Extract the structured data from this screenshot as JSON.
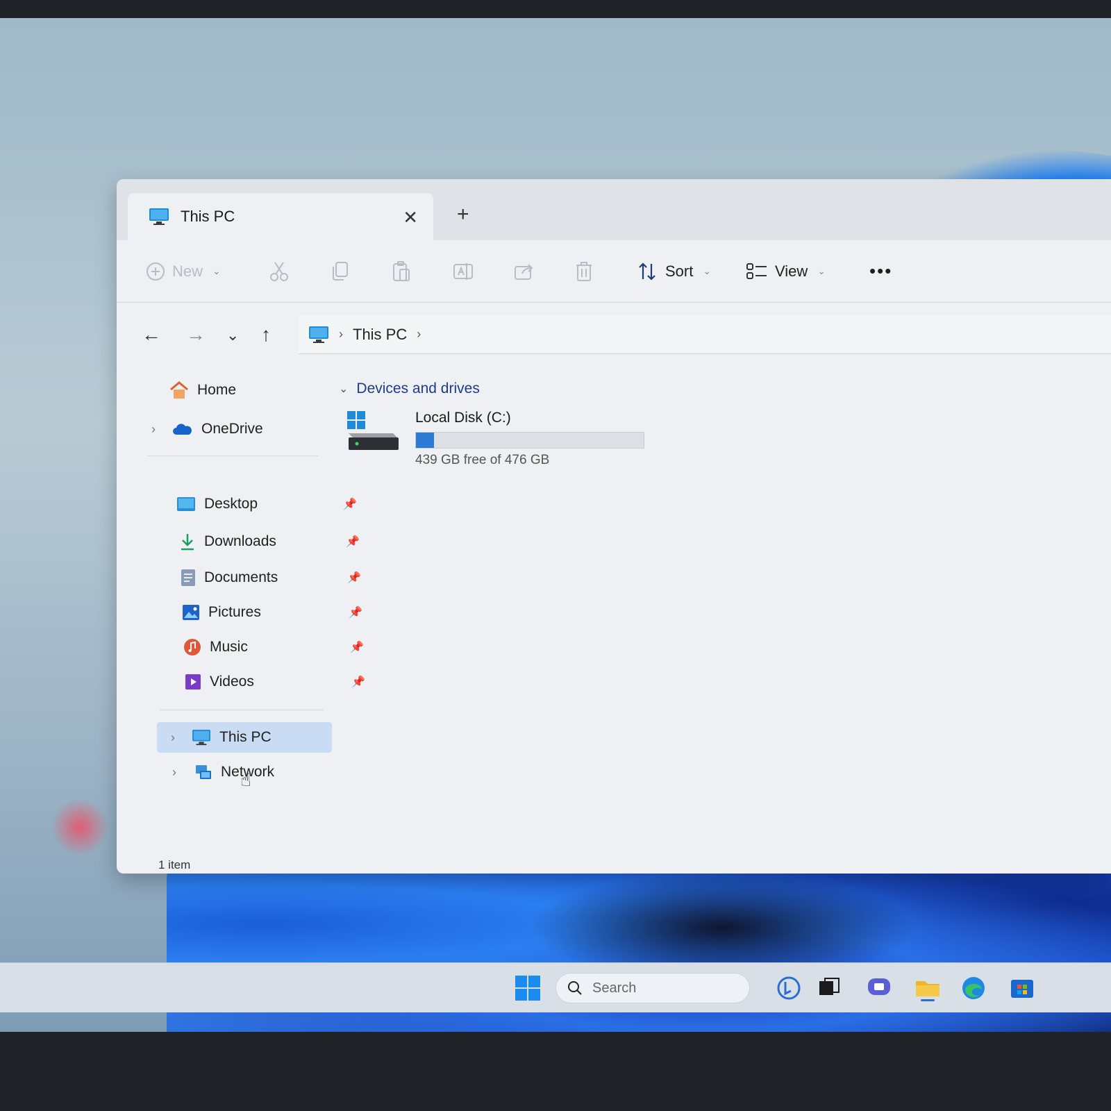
{
  "window": {
    "tab_title": "This PC",
    "new_tab_symbol": "+"
  },
  "toolbar": {
    "new_label": "New",
    "sort_label": "Sort",
    "view_label": "View",
    "more_label": "•••"
  },
  "address": {
    "crumbs": [
      "This PC"
    ]
  },
  "sidebar": {
    "items": [
      {
        "label": "Home",
        "icon": "home-icon"
      },
      {
        "label": "OneDrive",
        "icon": "onedrive-icon"
      },
      {
        "label": "Desktop",
        "icon": "desktop-folder-icon",
        "pinned": true
      },
      {
        "label": "Downloads",
        "icon": "downloads-icon",
        "pinned": true
      },
      {
        "label": "Documents",
        "icon": "documents-icon",
        "pinned": true
      },
      {
        "label": "Pictures",
        "icon": "pictures-icon",
        "pinned": true
      },
      {
        "label": "Music",
        "icon": "music-icon",
        "pinned": true
      },
      {
        "label": "Videos",
        "icon": "videos-icon",
        "pinned": true
      },
      {
        "label": "This PC",
        "icon": "this-pc-icon",
        "selected": true
      },
      {
        "label": "Network",
        "icon": "network-icon"
      }
    ]
  },
  "content": {
    "group_title": "Devices and drives",
    "drive": {
      "name": "Local Disk (C:)",
      "free_text": "439 GB free of 476 GB",
      "used_fraction": 0.078
    }
  },
  "status": {
    "item_count": "1 item"
  },
  "taskbar": {
    "search_placeholder": "Search"
  },
  "colors": {
    "accent": "#2a7ad6",
    "group_header": "#1d3b8a",
    "selected_bg": "#c9dcf3"
  }
}
